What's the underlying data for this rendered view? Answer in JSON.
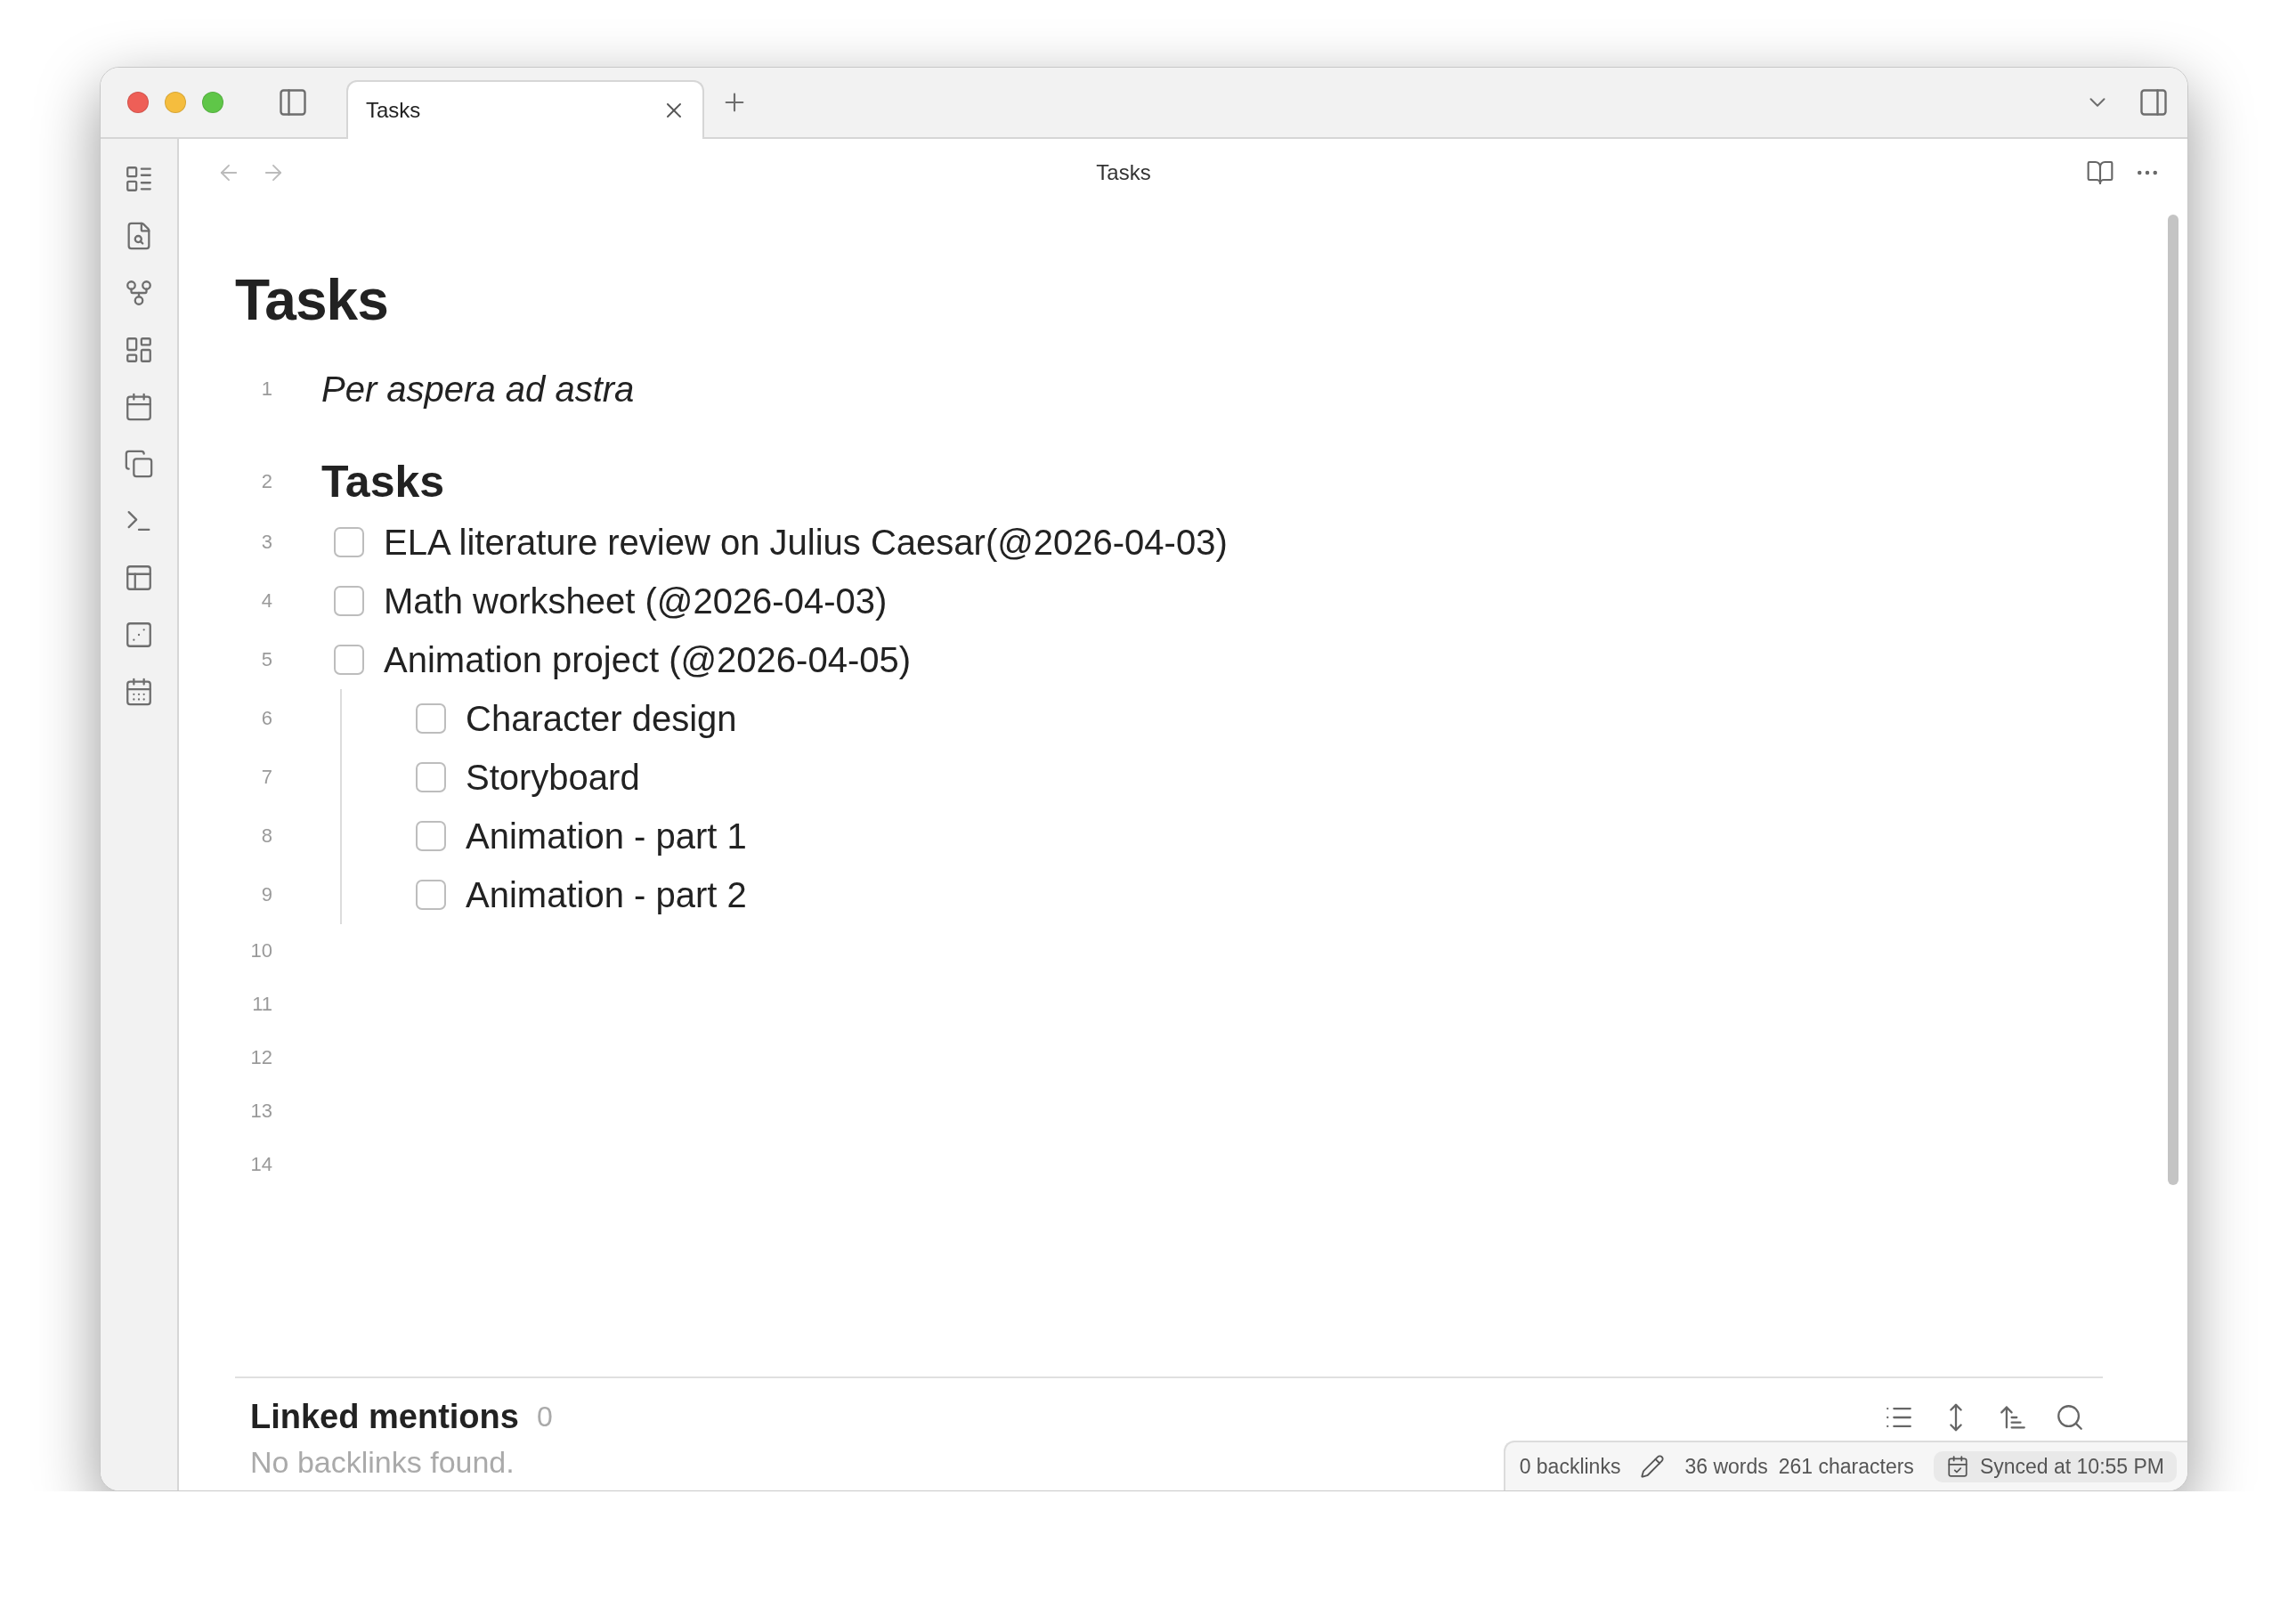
{
  "tabs": [
    {
      "label": "Tasks",
      "selected": true
    }
  ],
  "header": {
    "title": "Tasks"
  },
  "note": {
    "title": "Tasks",
    "lines": [
      {
        "number": "1",
        "kind": "italic",
        "text": "Per aspera ad astra"
      },
      {
        "number": "2",
        "kind": "heading",
        "text": "Tasks"
      },
      {
        "number": "3",
        "kind": "task",
        "text": "ELA literature review on Julius Caesar(@2026-04-03)",
        "checked": false
      },
      {
        "number": "4",
        "kind": "task",
        "text": "Math worksheet (@2026-04-03)",
        "checked": false
      },
      {
        "number": "5",
        "kind": "task",
        "text": "Animation project (@2026-04-05)",
        "checked": false,
        "children": [
          {
            "number": "6",
            "kind": "task",
            "text": "Character design",
            "checked": false
          },
          {
            "number": "7",
            "kind": "task",
            "text": "Storyboard",
            "checked": false
          },
          {
            "number": "8",
            "kind": "task",
            "text": "Animation - part 1",
            "checked": false
          },
          {
            "number": "9",
            "kind": "task",
            "text": "Animation - part 2",
            "checked": false
          }
        ]
      },
      {
        "number": "10",
        "kind": "empty"
      },
      {
        "number": "11",
        "kind": "empty"
      },
      {
        "number": "12",
        "kind": "empty"
      },
      {
        "number": "13",
        "kind": "empty"
      },
      {
        "number": "14",
        "kind": "empty"
      }
    ]
  },
  "backlinks": {
    "title": "Linked mentions",
    "count": "0",
    "empty_text": "No backlinks found."
  },
  "status_bar": {
    "backlinks": "0 backlinks",
    "words": "36 words",
    "characters": "261 characters",
    "sync": "Synced at 10:55 PM"
  }
}
